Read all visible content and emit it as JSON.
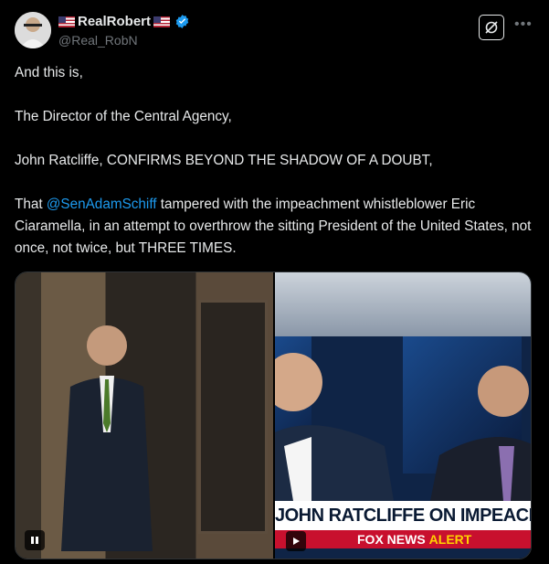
{
  "author": {
    "display_name": "RealRobert",
    "handle": "@Real_RobN",
    "verified": true,
    "avatar_icon": "avatar-photo"
  },
  "header_icons": {
    "grok": "grok-icon",
    "more": "more-icon"
  },
  "tweet": {
    "line1": "And this is,",
    "line2": "The Director of the Central Agency,",
    "line3": "John Ratcliffe, CONFIRMS BEYOND THE SHADOW OF A DOUBT,",
    "line4_prefix": "That ",
    "mention": "@SenAdamSchiff",
    "line4_rest": " tampered with the impeachment whistleblower Eric Ciaramella, in an attempt to overthrow the sitting President of the United States, not once, not twice, but THREE TIMES."
  },
  "media": {
    "chyron": "JOHN RATCLIFFE ON IMPEACHMENT",
    "alert_brand": "FOX NEWS",
    "alert_word": "ALERT",
    "left_control": "pause-icon",
    "right_control": "play-icon"
  },
  "colors": {
    "accent": "#1d9bf0",
    "background": "#000000",
    "text": "#e7e9ea",
    "muted": "#71767b"
  }
}
